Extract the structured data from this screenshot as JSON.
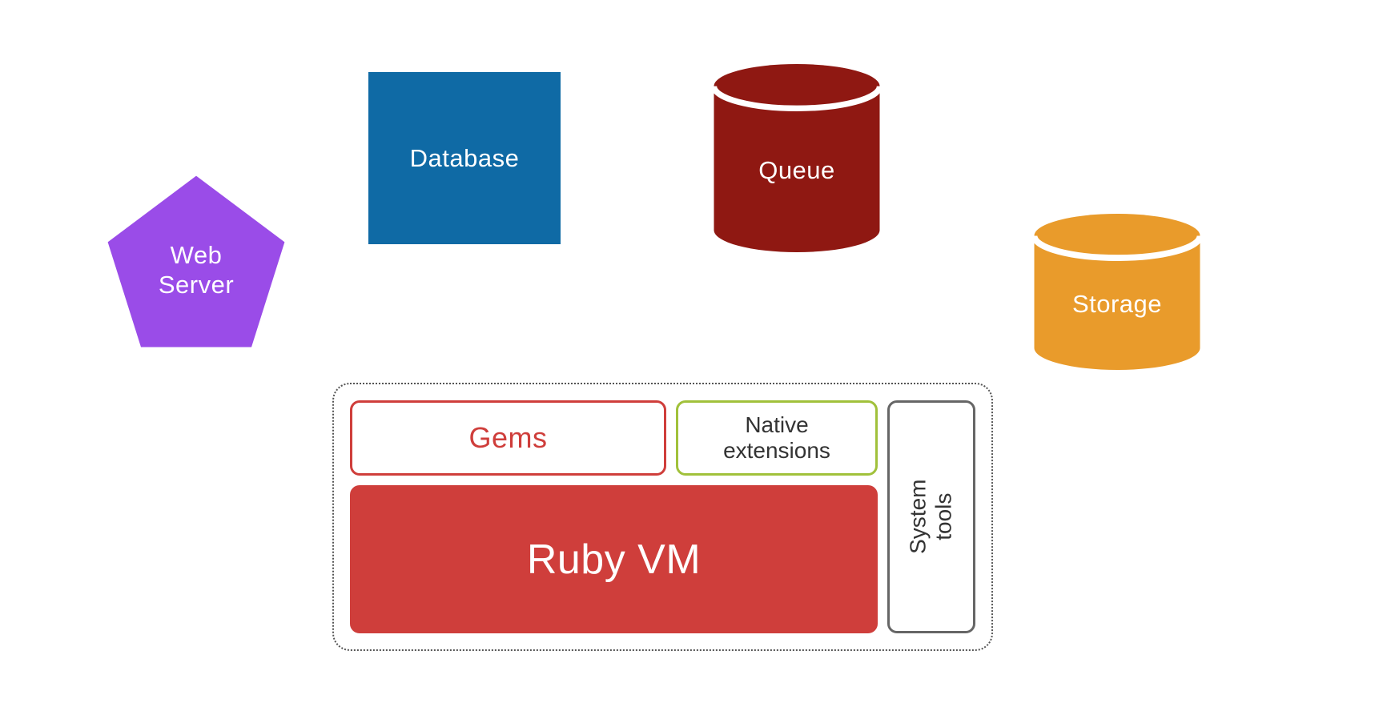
{
  "components": {
    "web_server": {
      "label_line1": "Web",
      "label_line2": "Server",
      "color": "#9a4ce8"
    },
    "database": {
      "label": "Database",
      "color": "#0f6aa5"
    },
    "queue": {
      "label": "Queue",
      "color": "#8f1812"
    },
    "storage": {
      "label": "Storage",
      "color": "#e99b2b"
    }
  },
  "runtime_container": {
    "gems": {
      "label": "Gems",
      "border_color": "#cf3e3b",
      "text_color": "#cf3e3b"
    },
    "native": {
      "label_line1": "Native",
      "label_line2": "extensions",
      "border_color": "#a1c13b"
    },
    "rubyvm": {
      "label": "Ruby VM",
      "bg_color": "#cf3e3b"
    },
    "system": {
      "label_line1": "System",
      "label_line2": "tools",
      "border_color": "#666666"
    }
  }
}
